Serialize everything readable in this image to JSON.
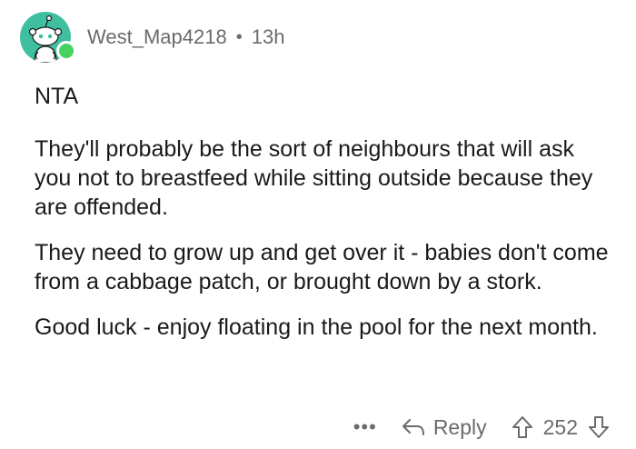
{
  "comment": {
    "author": "West_Map4218",
    "separator": "•",
    "time_ago": "13h",
    "paragraphs": [
      "NTA",
      "They'll probably be the sort of neighbours that will ask you not to breastfeed while sitting outside because they are offended.",
      "They need to grow up and get over it - babies don't come from a cabbage patch, or brought down by a stork.",
      "Good luck - enjoy floating in the pool for the next month."
    ]
  },
  "actions": {
    "more_label": "•••",
    "reply_label": "Reply",
    "score": "252"
  },
  "icons": {
    "avatar": "snoo-avatar-icon",
    "online": "online-status-dot",
    "reply": "reply-arrow-icon",
    "upvote": "upvote-arrow-icon",
    "downvote": "downvote-arrow-icon"
  },
  "colors": {
    "avatar_bg": "#3fbfa0",
    "online": "#46d160",
    "meta_text": "#6b6b6b"
  }
}
